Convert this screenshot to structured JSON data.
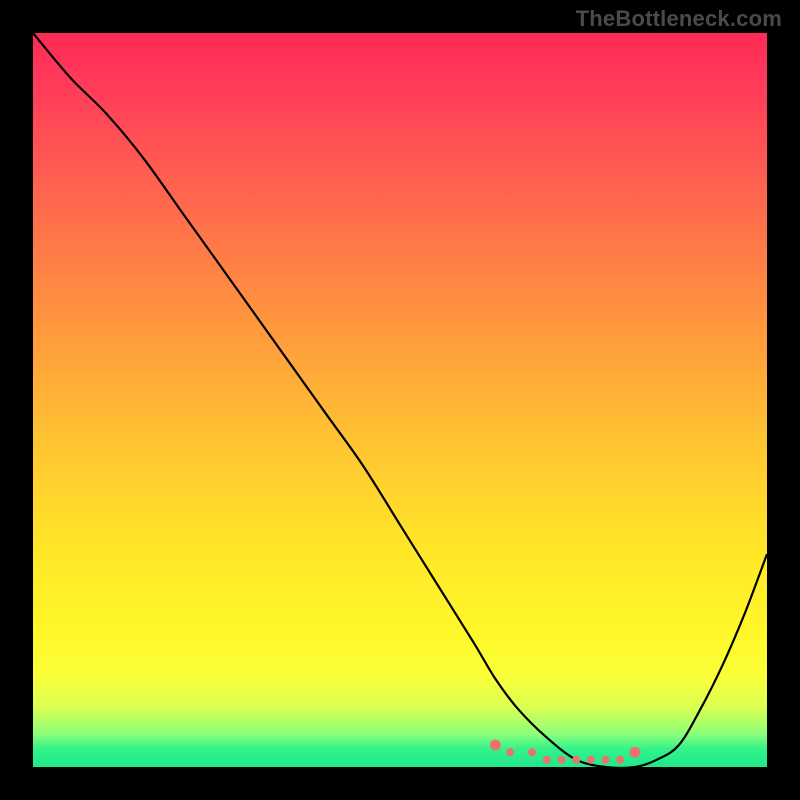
{
  "watermark": "TheBottleneck.com",
  "colors": {
    "background": "#000000",
    "curve": "#000000",
    "dots": "#e9746e",
    "top_gradient": "#ff2a55",
    "bottom_gradient": "#1fe98a"
  },
  "chart_data": {
    "type": "line",
    "title": "",
    "xlabel": "",
    "ylabel": "",
    "xlim": [
      0,
      100
    ],
    "ylim": [
      0,
      100
    ],
    "series": [
      {
        "name": "bottleneck-curve",
        "x": [
          0,
          5,
          10,
          15,
          20,
          25,
          30,
          35,
          40,
          45,
          50,
          55,
          60,
          63,
          66,
          70,
          74,
          78,
          82,
          85,
          88,
          91,
          94,
          97,
          100
        ],
        "values": [
          100,
          94,
          89,
          83,
          76,
          69,
          62,
          55,
          48,
          41,
          33,
          25,
          17,
          12,
          8,
          4,
          1,
          0,
          0,
          1,
          3,
          8,
          14,
          21,
          29
        ]
      }
    ],
    "annotations": {
      "optimal_range_x": [
        63,
        82
      ],
      "optimal_dots_x": [
        63,
        65,
        68,
        70,
        72,
        74,
        76,
        78,
        80,
        82
      ],
      "optimal_dots_y": [
        3,
        2,
        2,
        1,
        1,
        1,
        1,
        1,
        1,
        2
      ]
    }
  }
}
